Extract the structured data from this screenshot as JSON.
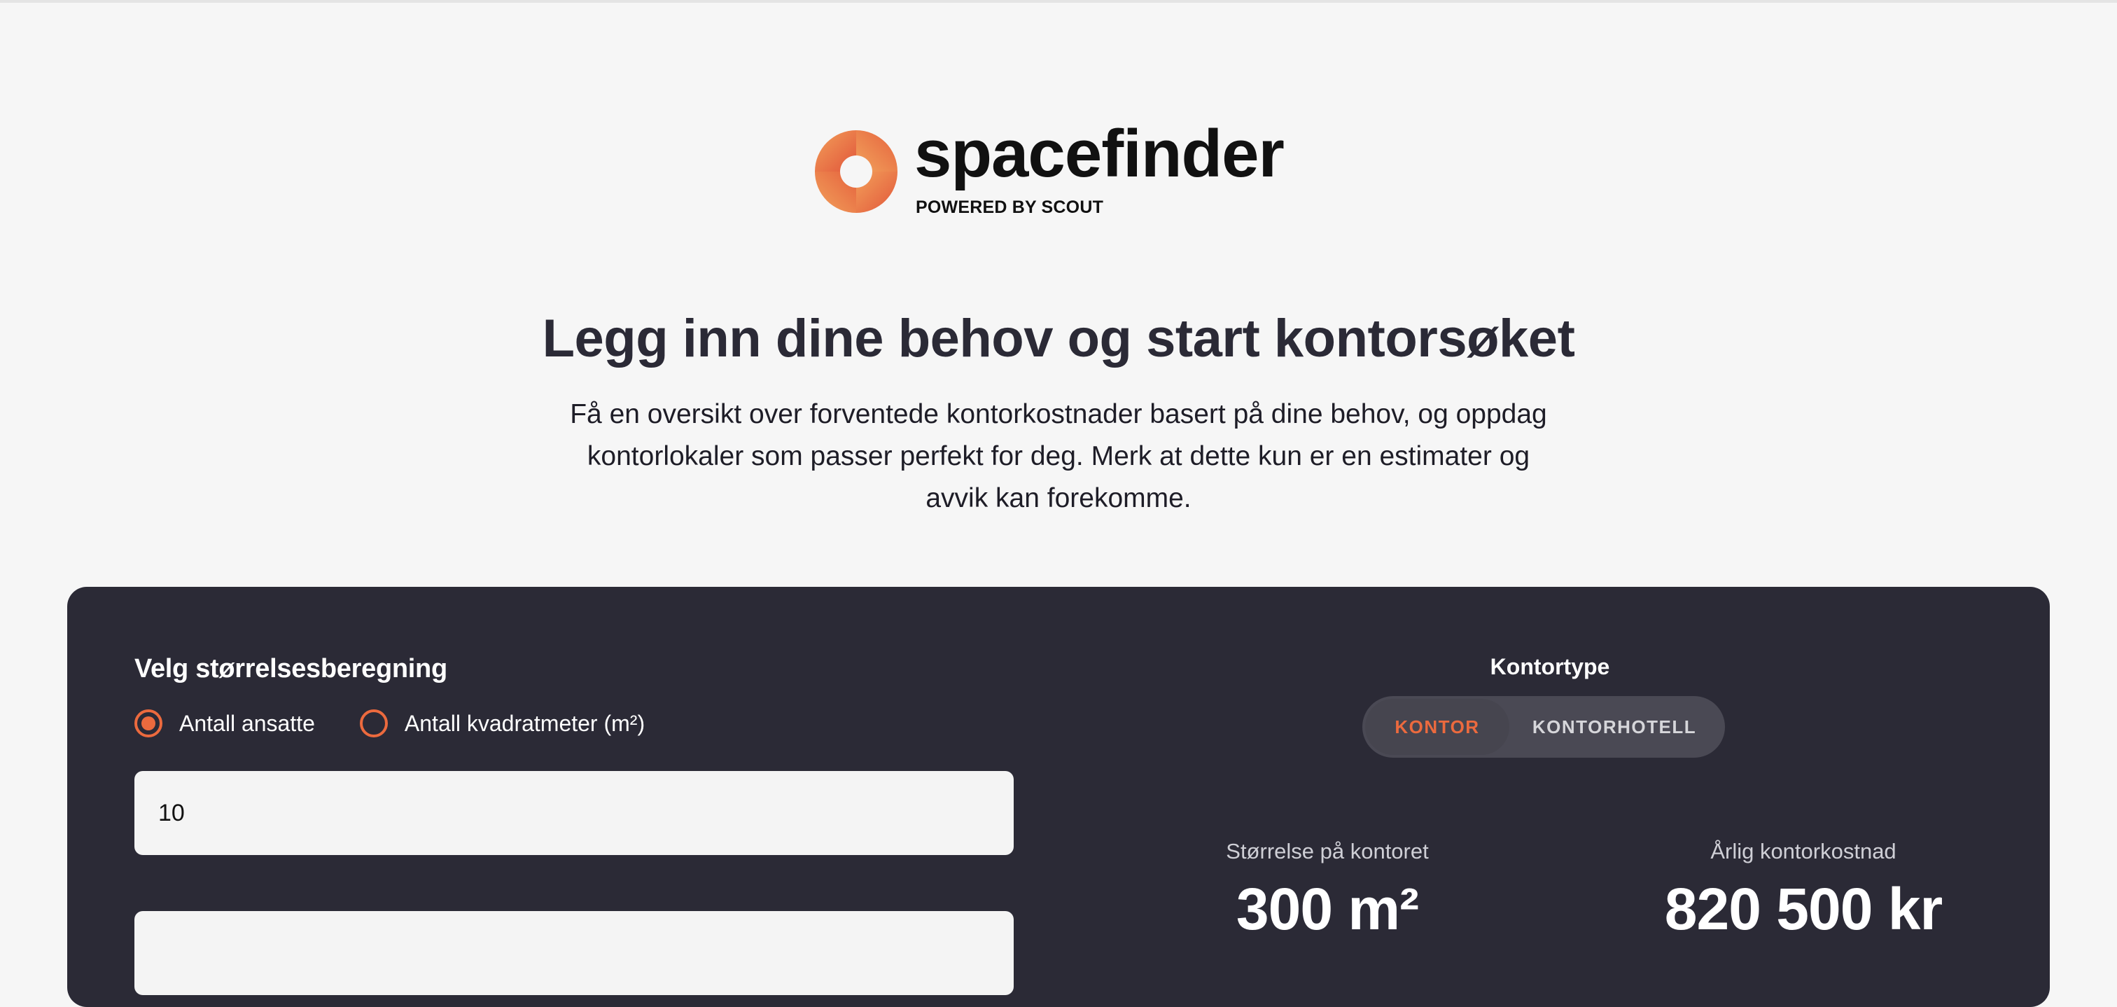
{
  "brand": {
    "name": "spacefinder",
    "tagline": "POWERED BY SCOUT",
    "gradient_start": "#f0904e",
    "gradient_end": "#e1553a"
  },
  "hero": {
    "title": "Legg inn dine behov og start kontorsøket",
    "description": "Få en oversikt over forventede kontorkostnader basert på dine behov, og oppdag kontorlokaler som passer perfekt for deg. Merk at dette kun er en estimater og avvik kan forekomme."
  },
  "calculator": {
    "size_heading": "Velg størrelsesberegning",
    "options": [
      {
        "label": "Antall ansatte",
        "checked": true
      },
      {
        "label": "Antall kvadratmeter (m²)",
        "checked": false
      }
    ],
    "input_value": "10",
    "second_input_value": "",
    "office_type_label": "Kontortype",
    "office_types": [
      {
        "label": "KONTOR",
        "active": true
      },
      {
        "label": "KONTORHOTELL",
        "active": false
      }
    ],
    "results": {
      "size_label": "Størrelse på kontoret",
      "size_value": "300 m²",
      "cost_label": "Årlig kontorkostnad",
      "cost_value": "820 500 kr"
    }
  },
  "colors": {
    "accent": "#ec6a3e",
    "panel_bg": "#2b2a36",
    "page_bg": "#f6f6f6"
  }
}
